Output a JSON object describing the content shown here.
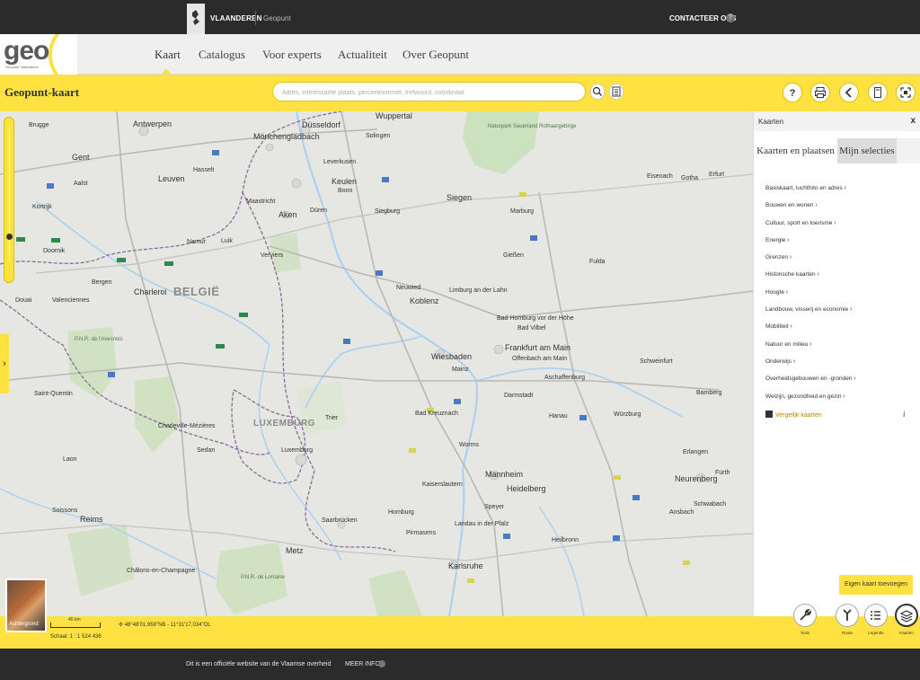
{
  "topbar": {
    "org": "VLAANDEREN",
    "site": "Geopunt",
    "contact": "CONTACTEER ONS",
    "help_glyph": "?"
  },
  "logo": {
    "text": "geo",
    "subtitle": "Geopunt Vlaanderen"
  },
  "nav": {
    "items": [
      "Kaart",
      "Catalogus",
      "Voor experts",
      "Actualiteit",
      "Over Geopunt"
    ],
    "active": "Kaart"
  },
  "toolbar": {
    "title": "Geopunt-kaart",
    "search_placeholder": "Adres, interessante plaats, perceelnummer, trefwoord, coördinaat",
    "search_icon": "magnifier-icon",
    "list_icon": "list-icon",
    "help_glyph": "?",
    "actions": [
      "help-icon",
      "print-icon",
      "share-icon",
      "bookmark-icon",
      "fullscreen-icon"
    ]
  },
  "map": {
    "country_labels": [
      "BELGIË",
      "LUXEMBURG"
    ],
    "city_labels": [
      "Antwerpen",
      "Leuven",
      "Brugge",
      "Gent",
      "Aalst",
      "Kortrijk",
      "Doornik",
      "Bergen",
      "Charleroi",
      "Namur",
      "Luik",
      "Verviers",
      "Hasselt",
      "Maastricht",
      "Aken",
      "Düren",
      "Keulen",
      "Düsseldorf",
      "Mönchengladbach",
      "Wuppertal",
      "Solingen",
      "Leverkusen",
      "Bonn",
      "Siegburg",
      "Siegen",
      "Koblenz",
      "Neuwied",
      "Limburg an der Lahn",
      "Wiesbaden",
      "Mainz",
      "Frankfurt am Main",
      "Offenbach am Main",
      "Darmstadt",
      "Aschaffenburg",
      "Bad Kreuznach",
      "Trier",
      "Luxemburg",
      "Saarbrücken",
      "Kaiserslautern",
      "Mannheim",
      "Heidelberg",
      "Karlsruhe",
      "Heilbronn",
      "Würzburg",
      "Schweinfurt",
      "Bamberg",
      "Erlangen",
      "Neurenberg",
      "Fulda",
      "Marburg",
      "Gießen",
      "Metz",
      "Reims",
      "Charleville-Mézières",
      "Sedan",
      "Châlons-en-Champagne",
      "Valenciennes",
      "Douai",
      "Saint-Quentin",
      "Laon",
      "Soissons",
      "Erfurt",
      "Eisenach",
      "Gotha",
      "Fürth",
      "Ansbach",
      "Schwabach",
      "Speyer",
      "Worms",
      "Homburg",
      "Pirmasens",
      "Landau in der Pfalz",
      "Bad Homburg vor der Höhe",
      "Hanau",
      "Bad Vilbel"
    ],
    "park_labels": [
      "Naturpark Sauerland Rothaargebirge",
      "P.N.R. de l'Avesnois",
      "P.N.R. de Lorraine"
    ]
  },
  "panel": {
    "title": "Kaarten",
    "close_glyph": "x",
    "tabs": [
      "Kaarten en plaatsen",
      "Mijn selecties"
    ],
    "active_tab": "Kaarten en plaatsen",
    "categories": [
      "Basiskaart, luchtfoto en adres",
      "Bouwen en wonen",
      "Cultuur, sport en toerisme",
      "Energie",
      "Grenzen",
      "Historische kaarten",
      "Hoogte",
      "Landbouw, visserij en economie",
      "Mobiliteit",
      "Natuur en milieu",
      "Onderwijs",
      "Overheidsgebouwen en -gronden",
      "Welzijn, gezondheid en gezin"
    ],
    "compare_label": "Vergelijk kaarten",
    "info_glyph": "i",
    "add_map_label": "Eigen kaart toevoegen"
  },
  "status": {
    "background_label": "Achtergrond",
    "scale_bar_label": "40 km",
    "scale_text": "Schaal: 1 : 1 524 436",
    "coordinates": "48°48'01,958\"NB - 11°31'17,034\"OL"
  },
  "tools": [
    {
      "label": "Tools",
      "icon": "wrench-icon"
    },
    {
      "label": "Route",
      "icon": "route-icon"
    },
    {
      "label": "Legende",
      "icon": "legend-icon"
    },
    {
      "label": "Kaarten",
      "icon": "layers-icon"
    }
  ],
  "footer": {
    "text": "Dit is een officiële website van de Vlaamse overheid",
    "more": "MEER INFO"
  },
  "colors": {
    "accent": "#ffe141",
    "dark": "#2b2b2b",
    "map_bg": "#e6e6e3",
    "water": "#a9d0f0",
    "forest": "#c6e0b4",
    "border": "#8a6a9a"
  }
}
